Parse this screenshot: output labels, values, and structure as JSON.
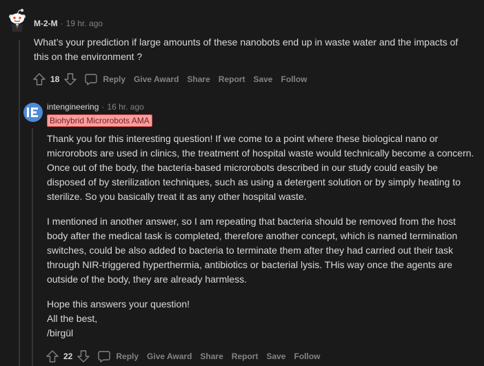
{
  "top_comment": {
    "author": "M-2-M",
    "time": "19 hr. ago",
    "body": "What’s your prediction if large amounts of these nanobots end up in waste water and the impacts of this on the environment ?",
    "score": "18",
    "actions": {
      "reply": "Reply",
      "give_award": "Give Award",
      "share": "Share",
      "report": "Report",
      "save": "Save",
      "follow": "Follow"
    }
  },
  "reply_comment": {
    "author": "intengineering",
    "time": "16 hr. ago",
    "avatar_text": "IE",
    "flair": "Biohybrid Microrobots AMA",
    "paragraphs": [
      "Thank you for this interesting question! If we come to a point where these biological nano or microrobots are used in clinics, the treatment of hospital waste would technically become a concern. Once out of the body, the bacteria-based microrobots described in our study could easily be disposed of by sterilization techniques, such as using a detergent solution or by simply heating to sterilize. So you basically treat it as any other hospital waste.",
      "I mentioned in another answer, so I am repeating that bacteria should be removed from the host body after the medical task is completed, therefore another concept, which is named termination switches, could be also added to bacteria to terminate them after they had carried out their task through NIR-triggered hyperthermia, antibiotics or bacterial lysis. THis way once the agents are outside of the body, they are already harmless."
    ],
    "signoff": {
      "line1": "Hope this answers your question!",
      "line2": "All the best,",
      "line3": "/birgül"
    },
    "score": "22",
    "actions": {
      "reply": "Reply",
      "give_award": "Give Award",
      "share": "Share",
      "report": "Report",
      "save": "Save",
      "follow": "Follow"
    }
  },
  "colors": {
    "background": "#1a1a1b",
    "text": "#d7dadc",
    "muted": "#818384",
    "flair_bg": "#f7a0a0",
    "avatar_ie": "#4f8bd6"
  },
  "icons": {
    "upvote": "arrow-up-icon",
    "downvote": "arrow-down-icon",
    "comment": "comment-bubble-icon",
    "avatar_top": "snoo-avatar-icon"
  }
}
